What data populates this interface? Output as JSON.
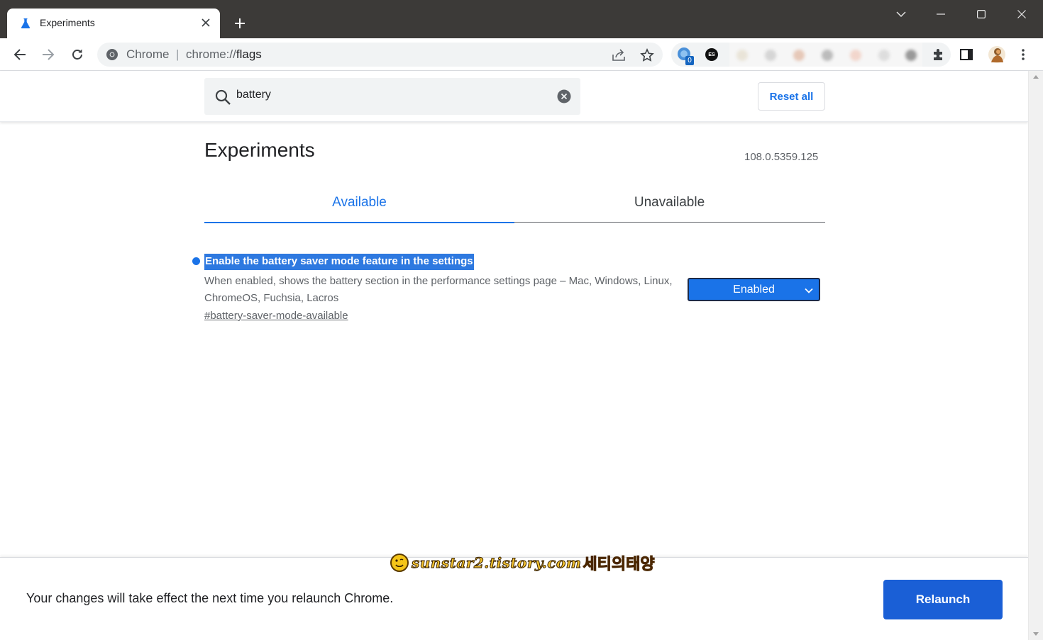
{
  "browser": {
    "tab_title": "Experiments",
    "omnibox_site": "Chrome",
    "omnibox_separator": "|",
    "omnibox_scheme": "chrome://",
    "omnibox_path": "flags",
    "extension_badge": "0",
    "extension_label": "ES"
  },
  "search": {
    "value": "battery",
    "reset_label": "Reset all"
  },
  "page": {
    "title": "Experiments",
    "version": "108.0.5359.125",
    "tabs": [
      {
        "label": "Available",
        "active": true
      },
      {
        "label": "Unavailable",
        "active": false
      }
    ]
  },
  "experiment": {
    "name": "Enable the battery saver mode feature in the settings",
    "description": "When enabled, shows the battery section in the performance settings page – Mac, Windows, Linux, ChromeOS, Fuchsia, Lacros",
    "link": "#battery-saver-mode-available",
    "selected_value": "Enabled"
  },
  "bottom": {
    "message": "Your changes will take effect the next time you relaunch Chrome.",
    "relaunch_label": "Relaunch"
  },
  "watermark": {
    "url": "sunstar2.tistory.com",
    "name": "세티의태양"
  },
  "colors": {
    "accent": "#1a73e8",
    "relaunch": "#1a5fd6",
    "titlebar": "#3c3a38",
    "selection": "#2e79e0"
  }
}
